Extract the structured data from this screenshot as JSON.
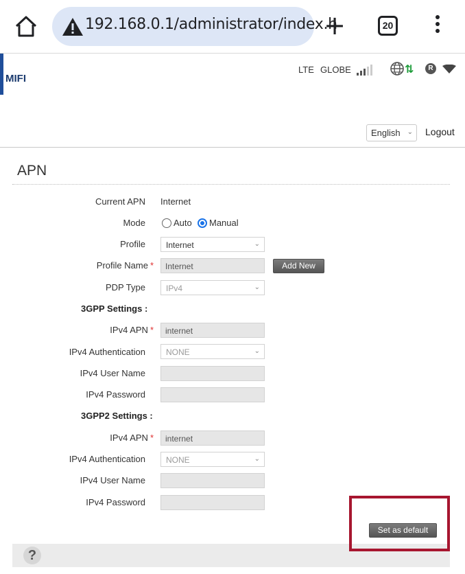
{
  "browser": {
    "url": "192.168.0.1/administrator/index.h",
    "new_tab_symbol": "+",
    "tab_count": "20"
  },
  "header": {
    "brand": "MIFI",
    "network_type": "LTE",
    "operator": "GLOBE",
    "roaming_indicator": "R",
    "data_arrows": "⇅",
    "language": "English",
    "logout": "Logout"
  },
  "page": {
    "title": "APN"
  },
  "form": {
    "current_apn_label": "Current APN",
    "current_apn_value": "Internet",
    "mode_label": "Mode",
    "mode_options": [
      "Auto",
      "Manual"
    ],
    "mode_selected": "Manual",
    "profile_label": "Profile",
    "profile_value": "Internet",
    "profile_name_label": "Profile Name",
    "profile_name_value": "Internet",
    "add_new_button": "Add New",
    "pdp_type_label": "PDP Type",
    "pdp_type_value": "IPv4",
    "required_marker": "*",
    "gpp": {
      "section_title": "3GPP Settings :",
      "ipv4_apn_label": "IPv4 APN",
      "ipv4_apn_value": "internet",
      "ipv4_auth_label": "IPv4 Authentication",
      "ipv4_auth_value": "NONE",
      "ipv4_user_label": "IPv4 User Name",
      "ipv4_user_value": "",
      "ipv4_pass_label": "IPv4 Password",
      "ipv4_pass_value": ""
    },
    "gpp2": {
      "section_title": "3GPP2 Settings :",
      "ipv4_apn_label": "IPv4 APN",
      "ipv4_apn_value": "internet",
      "ipv4_auth_label": "IPv4 Authentication",
      "ipv4_auth_value": "NONE",
      "ipv4_user_label": "IPv4 User Name",
      "ipv4_user_value": "",
      "ipv4_pass_label": "IPv4 Password",
      "ipv4_pass_value": ""
    },
    "set_default_button": "Set as default"
  },
  "footer": {
    "help_symbol": "?"
  },
  "colors": {
    "accent_bar": "#1f4e9a",
    "url_pill": "#dde6f6",
    "highlight_box": "#a7162f",
    "radio_checked": "#1a73e8",
    "required_marker": "#e03030",
    "data_arrows": "#1e9c3a"
  }
}
